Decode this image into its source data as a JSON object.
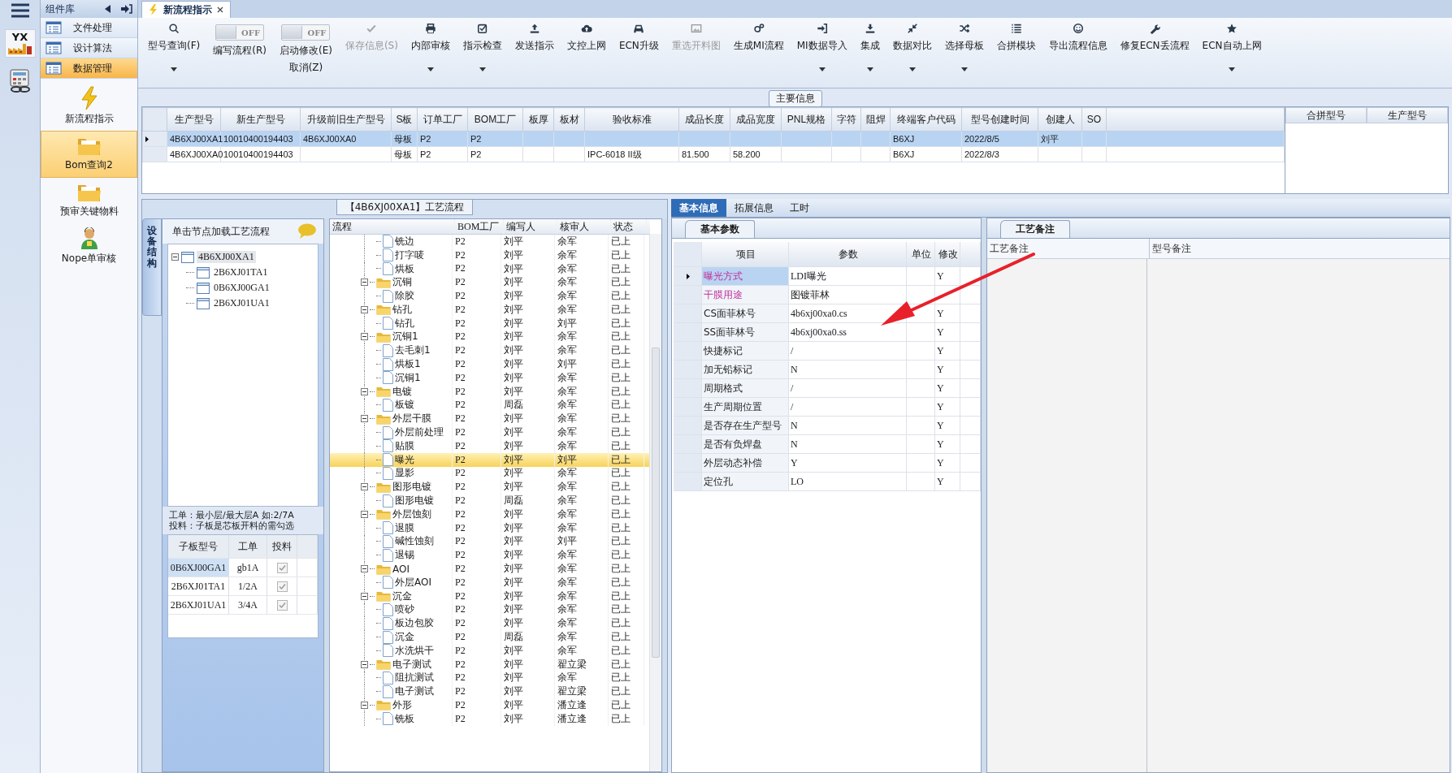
{
  "logo_text": "YX",
  "sidebar": {
    "title": "组件库",
    "nav": [
      {
        "label": "文件处理",
        "selected": false
      },
      {
        "label": "设计算法",
        "selected": false
      },
      {
        "label": "数据管理",
        "selected": true
      }
    ],
    "modules": [
      {
        "label": "新流程指示",
        "selected": false
      },
      {
        "label": "Bom查询2",
        "selected": true
      },
      {
        "label": "预审关键物料",
        "selected": false
      },
      {
        "label": "Nope单审核",
        "selected": false
      }
    ]
  },
  "tab": {
    "title": "新流程指示"
  },
  "toolbar": [
    {
      "kind": "button",
      "label": "型号查询(F)",
      "dropdown": true,
      "disabled": false
    },
    {
      "kind": "toggle",
      "label": "编写流程(R)",
      "on": false,
      "switch_text": "OFF"
    },
    {
      "kind": "toggle",
      "label": "启动修改(E)",
      "sub_label": "取消(Z)",
      "on": false,
      "switch_text": "OFF"
    },
    {
      "kind": "button",
      "label": "保存信息(S)",
      "dropdown": false,
      "disabled": true
    },
    {
      "kind": "button",
      "label": "内部审核",
      "dropdown": true,
      "disabled": false
    },
    {
      "kind": "button",
      "label": "指示检查",
      "dropdown": true,
      "disabled": false
    },
    {
      "kind": "button",
      "label": "发送指示",
      "dropdown": false,
      "disabled": false
    },
    {
      "kind": "button",
      "label": "文控上网",
      "dropdown": false,
      "disabled": false
    },
    {
      "kind": "button",
      "label": "ECN升级",
      "dropdown": false,
      "disabled": false
    },
    {
      "kind": "button",
      "label": "重选开料图",
      "dropdown": false,
      "disabled": true
    },
    {
      "kind": "button",
      "label": "生成MI流程",
      "dropdown": false,
      "disabled": false
    },
    {
      "kind": "button",
      "label": "MI数据导入",
      "dropdown": true,
      "disabled": false
    },
    {
      "kind": "button",
      "label": "集成",
      "dropdown": true,
      "disabled": false
    },
    {
      "kind": "button",
      "label": "数据对比",
      "dropdown": true,
      "disabled": false
    },
    {
      "kind": "button",
      "label": "选择母板",
      "dropdown": true,
      "disabled": false
    },
    {
      "kind": "button",
      "label": "合拼模块",
      "dropdown": false,
      "disabled": false
    },
    {
      "kind": "button",
      "label": "导出流程信息",
      "dropdown": false,
      "disabled": false
    },
    {
      "kind": "button",
      "label": "修复ECN丢流程",
      "dropdown": false,
      "disabled": false
    },
    {
      "kind": "button",
      "label": "ECN自动上网",
      "dropdown": true,
      "disabled": false
    }
  ],
  "main_info": {
    "title": "主要信息",
    "columns": [
      "生产型号",
      "新生产型号",
      "升级前旧生产型号",
      "S板",
      "订单工厂",
      "BOM工厂",
      "板厚",
      "板材",
      "验收标准",
      "成品长度",
      "成品宽度",
      "PNL规格",
      "字符",
      "阻焊",
      "终端客户代码",
      "型号创建时间",
      "创建人",
      "SO"
    ],
    "rows": [
      {
        "selected": true,
        "cells": [
          "4B6XJ00XA1",
          "10010400194403",
          "4B6XJ00XA0",
          "母板",
          "P2",
          "P2",
          null,
          null,
          null,
          null,
          null,
          null,
          null,
          null,
          "B6XJ",
          "2022/8/5",
          "刘平",
          null
        ]
      },
      {
        "selected": false,
        "cells": [
          "4B6XJ00XA0",
          "10010400194403",
          null,
          "母板",
          "P2",
          "P2",
          null,
          null,
          "IPC-6018 II级",
          "81.500",
          "58.200",
          null,
          null,
          null,
          "B6XJ",
          "2022/8/3",
          null,
          null
        ]
      }
    ],
    "side_columns": [
      "合拼型号",
      "生产型号"
    ]
  },
  "process": {
    "title": "【4B6XJ00XA1】工艺流程",
    "side_tab": "设备结构",
    "hint": "单击节点加载工艺流程",
    "boards": {
      "name": "4B6XJ00XA1",
      "selected": true,
      "children": [
        {
          "name": "2B6XJ01TA1",
          "selected": false
        },
        {
          "name": "0B6XJ00GA1",
          "selected": false
        },
        {
          "name": "2B6XJ01UA1",
          "selected": false
        }
      ]
    },
    "notes": [
      "工单：最小层/最大层A 如:2/7A",
      "投料：子板是芯板开料的需勾选"
    ],
    "sub_table": {
      "columns": [
        "子板型号",
        "工单",
        "投料"
      ],
      "rows": [
        {
          "board": "0B6XJ00GA1",
          "order": "gb1A",
          "feed": true,
          "selected": true
        },
        {
          "board": "2B6XJ01TA1",
          "order": "1/2A",
          "feed": true,
          "selected": false
        },
        {
          "board": "2B6XJ01UA1",
          "order": "3/4A",
          "feed": true,
          "selected": false
        }
      ]
    },
    "flow": {
      "columns": [
        "流程",
        "BOM工厂",
        "编写人",
        "核审人",
        "状态"
      ],
      "nodes": [
        {
          "kind": "file",
          "name": "铣边",
          "bom": "P2",
          "writer": "刘平",
          "reviewer": "余军",
          "status": "已上",
          "selected": false
        },
        {
          "kind": "file",
          "name": "打字唛",
          "bom": "P2",
          "writer": "刘平",
          "reviewer": "余军",
          "status": "已上",
          "selected": false
        },
        {
          "kind": "file",
          "name": "烘板",
          "bom": "P2",
          "writer": "刘平",
          "reviewer": "余军",
          "status": "已上",
          "selected": false
        },
        {
          "kind": "folder",
          "name": "沉铜",
          "bom": "P2",
          "writer": "刘平",
          "reviewer": "余军",
          "status": "已上",
          "selected": false,
          "expanded": true,
          "children": [
            {
              "kind": "file",
              "name": "除胶",
              "bom": "P2",
              "writer": "刘平",
              "reviewer": "余军",
              "status": "已上",
              "selected": false
            }
          ]
        },
        {
          "kind": "folder",
          "name": "钻孔",
          "bom": "P2",
          "writer": "刘平",
          "reviewer": "余军",
          "status": "已上",
          "selected": false,
          "expanded": true,
          "children": [
            {
              "kind": "file",
              "name": "钻孔",
              "bom": "P2",
              "writer": "刘平",
              "reviewer": "刘平",
              "status": "已上",
              "selected": false
            }
          ]
        },
        {
          "kind": "folder",
          "name": "沉铜1",
          "bom": "P2",
          "writer": "刘平",
          "reviewer": "余军",
          "status": "已上",
          "selected": false,
          "expanded": true,
          "children": [
            {
              "kind": "file",
              "name": "去毛刺1",
              "bom": "P2",
              "writer": "刘平",
              "reviewer": "余军",
              "status": "已上",
              "selected": false
            },
            {
              "kind": "file",
              "name": "烘板1",
              "bom": "P2",
              "writer": "刘平",
              "reviewer": "刘平",
              "status": "已上",
              "selected": false
            },
            {
              "kind": "file",
              "name": "沉铜1",
              "bom": "P2",
              "writer": "刘平",
              "reviewer": "余军",
              "status": "已上",
              "selected": false
            }
          ]
        },
        {
          "kind": "folder",
          "name": "电镀",
          "bom": "P2",
          "writer": "刘平",
          "reviewer": "余军",
          "status": "已上",
          "selected": false,
          "expanded": true,
          "children": [
            {
              "kind": "file",
              "name": "板镀",
              "bom": "P2",
              "writer": "周磊",
              "reviewer": "余军",
              "status": "已上",
              "selected": false
            }
          ]
        },
        {
          "kind": "folder",
          "name": "外层干膜",
          "bom": "P2",
          "writer": "刘平",
          "reviewer": "余军",
          "status": "已上",
          "selected": false,
          "expanded": true,
          "children": [
            {
              "kind": "file",
              "name": "外层前处理",
              "bom": "P2",
              "writer": "刘平",
              "reviewer": "余军",
              "status": "已上",
              "selected": false
            },
            {
              "kind": "file",
              "name": "贴膜",
              "bom": "P2",
              "writer": "刘平",
              "reviewer": "余军",
              "status": "已上",
              "selected": false
            },
            {
              "kind": "file",
              "name": "曝光",
              "bom": "P2",
              "writer": "刘平",
              "reviewer": "刘平",
              "status": "已上",
              "selected": true
            },
            {
              "kind": "file",
              "name": "显影",
              "bom": "P2",
              "writer": "刘平",
              "reviewer": "余军",
              "status": "已上",
              "selected": false
            }
          ]
        },
        {
          "kind": "folder",
          "name": "图形电镀",
          "bom": "P2",
          "writer": "刘平",
          "reviewer": "余军",
          "status": "已上",
          "selected": false,
          "expanded": true,
          "children": [
            {
              "kind": "file",
              "name": "图形电镀",
              "bom": "P2",
              "writer": "周磊",
              "reviewer": "余军",
              "status": "已上",
              "selected": false
            }
          ]
        },
        {
          "kind": "folder",
          "name": "外层蚀刻",
          "bom": "P2",
          "writer": "刘平",
          "reviewer": "余军",
          "status": "已上",
          "selected": false,
          "expanded": true,
          "children": [
            {
              "kind": "file",
              "name": "退膜",
              "bom": "P2",
              "writer": "刘平",
              "reviewer": "余军",
              "status": "已上",
              "selected": false
            },
            {
              "kind": "file",
              "name": "碱性蚀刻",
              "bom": "P2",
              "writer": "刘平",
              "reviewer": "刘平",
              "status": "已上",
              "selected": false
            },
            {
              "kind": "file",
              "name": "退锡",
              "bom": "P2",
              "writer": "刘平",
              "reviewer": "余军",
              "status": "已上",
              "selected": false
            }
          ]
        },
        {
          "kind": "folder",
          "name": "AOI",
          "bom": "P2",
          "writer": "刘平",
          "reviewer": "余军",
          "status": "已上",
          "selected": false,
          "expanded": true,
          "children": [
            {
              "kind": "file",
              "name": "外层AOI",
              "bom": "P2",
              "writer": "刘平",
              "reviewer": "余军",
              "status": "已上",
              "selected": false
            }
          ]
        },
        {
          "kind": "folder",
          "name": "沉金",
          "bom": "P2",
          "writer": "刘平",
          "reviewer": "余军",
          "status": "已上",
          "selected": false,
          "expanded": true,
          "children": [
            {
              "kind": "file",
              "name": "喷砂",
              "bom": "P2",
              "writer": "刘平",
              "reviewer": "余军",
              "status": "已上",
              "selected": false
            },
            {
              "kind": "file",
              "name": "板边包胶",
              "bom": "P2",
              "writer": "刘平",
              "reviewer": "余军",
              "status": "已上",
              "selected": false
            },
            {
              "kind": "file",
              "name": "沉金",
              "bom": "P2",
              "writer": "周磊",
              "reviewer": "余军",
              "status": "已上",
              "selected": false
            },
            {
              "kind": "file",
              "name": "水洗烘干",
              "bom": "P2",
              "writer": "刘平",
              "reviewer": "余军",
              "status": "已上",
              "selected": false
            }
          ]
        },
        {
          "kind": "folder",
          "name": "电子测试",
          "bom": "P2",
          "writer": "刘平",
          "reviewer": "翟立梁",
          "status": "已上",
          "selected": false,
          "expanded": true,
          "children": [
            {
              "kind": "file",
              "name": "阻抗测试",
              "bom": "P2",
              "writer": "刘平",
              "reviewer": "余军",
              "status": "已上",
              "selected": false
            },
            {
              "kind": "file",
              "name": "电子测试",
              "bom": "P2",
              "writer": "刘平",
              "reviewer": "翟立梁",
              "status": "已上",
              "selected": false
            }
          ]
        },
        {
          "kind": "folder",
          "name": "外形",
          "bom": "P2",
          "writer": "刘平",
          "reviewer": "潘立逢",
          "status": "已上",
          "selected": false,
          "expanded": true,
          "children": [
            {
              "kind": "file",
              "name": "铣板",
              "bom": "P2",
              "writer": "刘平",
              "reviewer": "潘立逢",
              "status": "已上",
              "selected": false
            }
          ]
        }
      ]
    }
  },
  "detail": {
    "tabs": [
      {
        "label": "基本信息",
        "selected": true
      },
      {
        "label": "拓展信息",
        "selected": false
      },
      {
        "label": "工时",
        "selected": false
      }
    ],
    "params": {
      "title": "基本参数",
      "columns": [
        "项目",
        "参数",
        "单位",
        "修改"
      ],
      "rows": [
        {
          "item": "曝光方式",
          "value": "LDI曝光",
          "modified": "Y",
          "selected": true,
          "required": true
        },
        {
          "item": "干膜用途",
          "value": "图镀菲林",
          "selected": false,
          "required": true
        },
        {
          "item": "CS面菲林号",
          "value": "4b6xj00xa0.cs",
          "modified": "Y",
          "selected": false,
          "required": false
        },
        {
          "item": "SS面菲林号",
          "value": "4b6xj00xa0.ss",
          "modified": "Y",
          "selected": false,
          "required": false
        },
        {
          "item": "快捷标记",
          "value": "/",
          "modified": "Y",
          "selected": false,
          "required": false
        },
        {
          "item": "加无铅标记",
          "value": "N",
          "modified": "Y",
          "selected": false,
          "required": false
        },
        {
          "item": "周期格式",
          "value": "/",
          "modified": "Y",
          "selected": false,
          "required": false
        },
        {
          "item": "生产周期位置",
          "value": "/",
          "modified": "Y",
          "selected": false,
          "required": false
        },
        {
          "item": "是否存在生产型号",
          "value": "N",
          "modified": "Y",
          "selected": false,
          "required": false
        },
        {
          "item": "是否有负焊盘",
          "value": "N",
          "modified": "Y",
          "selected": false,
          "required": false
        },
        {
          "item": "外层动态补偿",
          "value": "Y",
          "modified": "Y",
          "selected": false,
          "required": false
        },
        {
          "item": "定位孔",
          "value": "LO",
          "modified": "Y",
          "selected": false,
          "required": false
        }
      ]
    },
    "notes": {
      "title": "工艺备注",
      "columns": [
        "工艺备注",
        "型号备注"
      ]
    }
  },
  "annotation": {
    "kind": "arrow",
    "color": "#e8202a"
  }
}
